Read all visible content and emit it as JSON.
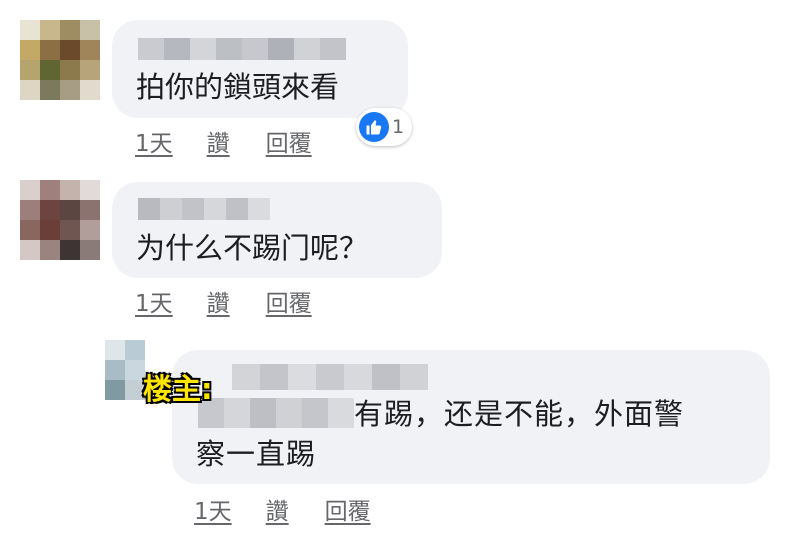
{
  "comments": [
    {
      "text": "拍你的鎖頭來看",
      "time": "1天",
      "like_label": "讚",
      "reply_label": "回覆",
      "reaction_count": "1"
    },
    {
      "text": "为什么不踢门呢？",
      "time": "1天",
      "like_label": "讚",
      "reply_label": "回覆"
    }
  ],
  "reply": {
    "op_label": "楼主:",
    "text_line1": "有踢，还是不能，外面警",
    "text_line2": "察一直踢",
    "time": "1天",
    "like_label": "讚",
    "reply_label": "回覆"
  },
  "colors": {
    "bubble": "#f0f2f5",
    "meta_text": "#65676b",
    "like_blue": "#1877f2",
    "op_badge": "#ffe600"
  },
  "icons": {
    "reaction": "thumbs-up-icon"
  }
}
